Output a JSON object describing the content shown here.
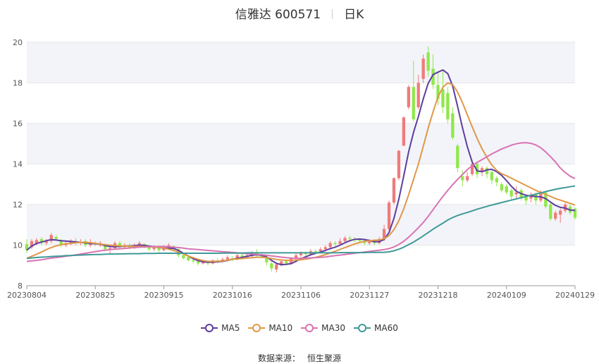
{
  "header": {
    "stock": "信雅达 600571",
    "period": "日K"
  },
  "footer": {
    "source_label": "数据来源：",
    "source_name": "恒生聚源"
  },
  "colors": {
    "up": "#f07b7b",
    "down": "#8fe84a",
    "grid": "#e6e6e6",
    "band": "#f3f4f9"
  },
  "chart_data": {
    "type": "candlestick",
    "ylim": [
      8,
      20
    ],
    "yticks": [
      8,
      10,
      12,
      14,
      16,
      18,
      20
    ],
    "xticks": [
      "20230804",
      "20230825",
      "20230915",
      "20231016",
      "20231106",
      "20231127",
      "20231218",
      "20240109",
      "20240129"
    ],
    "legend_position": "bottom",
    "grid": true,
    "candles": [
      [
        10.05,
        9.75,
        10.3,
        9.6
      ],
      [
        9.9,
        10.2,
        10.3,
        9.8
      ],
      [
        10.1,
        10.25,
        10.35,
        10.0
      ],
      [
        10.3,
        10.1,
        10.4,
        10.0
      ],
      [
        10.1,
        10.2,
        10.3,
        10.0
      ],
      [
        10.2,
        10.5,
        10.6,
        10.1
      ],
      [
        10.4,
        10.3,
        10.5,
        10.2
      ],
      [
        10.2,
        10.0,
        10.3,
        9.9
      ],
      [
        10.0,
        10.1,
        10.2,
        9.9
      ],
      [
        10.05,
        10.2,
        10.3,
        10.0
      ],
      [
        10.2,
        10.1,
        10.35,
        10.0
      ],
      [
        10.1,
        10.15,
        10.3,
        10.0
      ],
      [
        10.2,
        10.0,
        10.3,
        9.9
      ],
      [
        10.0,
        10.15,
        10.3,
        9.9
      ],
      [
        10.1,
        10.05,
        10.2,
        9.95
      ],
      [
        10.0,
        10.1,
        10.2,
        9.9
      ],
      [
        10.05,
        9.8,
        10.1,
        9.7
      ],
      [
        9.8,
        9.85,
        10.0,
        9.6
      ],
      [
        9.85,
        10.1,
        10.2,
        9.8
      ],
      [
        10.1,
        9.9,
        10.2,
        9.8
      ],
      [
        9.9,
        10.0,
        10.1,
        9.8
      ],
      [
        10.0,
        9.85,
        10.1,
        9.8
      ],
      [
        9.9,
        10.0,
        10.1,
        9.8
      ],
      [
        10.0,
        10.1,
        10.2,
        9.9
      ],
      [
        10.05,
        9.95,
        10.1,
        9.85
      ],
      [
        9.95,
        9.8,
        10.0,
        9.7
      ],
      [
        9.8,
        9.9,
        10.0,
        9.7
      ],
      [
        9.9,
        9.75,
        10.0,
        9.65
      ],
      [
        9.75,
        9.9,
        10.0,
        9.7
      ],
      [
        9.9,
        10.0,
        10.1,
        9.8
      ],
      [
        9.95,
        9.8,
        10.0,
        9.7
      ],
      [
        9.8,
        9.5,
        9.85,
        9.4
      ],
      [
        9.5,
        9.35,
        9.6,
        9.3
      ],
      [
        9.4,
        9.25,
        9.5,
        9.2
      ],
      [
        9.25,
        9.2,
        9.35,
        9.1
      ],
      [
        9.2,
        9.1,
        9.3,
        9.0
      ],
      [
        9.1,
        9.15,
        9.25,
        9.05
      ],
      [
        9.15,
        9.1,
        9.2,
        9.0
      ],
      [
        9.1,
        9.25,
        9.3,
        9.05
      ],
      [
        9.25,
        9.2,
        9.35,
        9.1
      ],
      [
        9.2,
        9.3,
        9.4,
        9.15
      ],
      [
        9.3,
        9.4,
        9.5,
        9.2
      ],
      [
        9.35,
        9.3,
        9.45,
        9.2
      ],
      [
        9.3,
        9.5,
        9.6,
        9.25
      ],
      [
        9.5,
        9.4,
        9.6,
        9.3
      ],
      [
        9.4,
        9.5,
        9.6,
        9.35
      ],
      [
        9.5,
        9.6,
        9.7,
        9.4
      ],
      [
        9.6,
        9.5,
        9.8,
        9.4
      ],
      [
        9.5,
        9.4,
        9.6,
        9.35
      ],
      [
        9.4,
        9.15,
        9.45,
        9.0
      ],
      [
        9.1,
        8.85,
        9.2,
        8.7
      ],
      [
        8.8,
        9.05,
        9.1,
        8.65
      ],
      [
        9.0,
        9.2,
        9.3,
        8.95
      ],
      [
        9.2,
        9.1,
        9.3,
        9.0
      ],
      [
        9.1,
        9.35,
        9.4,
        9.05
      ],
      [
        9.35,
        9.5,
        9.6,
        9.3
      ],
      [
        9.5,
        9.6,
        9.7,
        9.4
      ],
      [
        9.6,
        9.55,
        9.7,
        9.45
      ],
      [
        9.55,
        9.7,
        9.8,
        9.5
      ],
      [
        9.7,
        9.65,
        9.8,
        9.55
      ],
      [
        9.7,
        9.8,
        9.9,
        9.6
      ],
      [
        9.8,
        9.9,
        10.0,
        9.7
      ],
      [
        9.9,
        10.1,
        10.2,
        9.8
      ],
      [
        10.1,
        10.05,
        10.2,
        9.95
      ],
      [
        10.05,
        10.2,
        10.35,
        10.0
      ],
      [
        10.2,
        10.35,
        10.45,
        10.1
      ],
      [
        10.35,
        10.3,
        10.45,
        10.2
      ],
      [
        10.3,
        10.25,
        10.4,
        10.15
      ],
      [
        10.25,
        10.2,
        10.35,
        10.1
      ],
      [
        10.2,
        10.1,
        10.3,
        10.0
      ],
      [
        10.1,
        10.2,
        10.3,
        10.0
      ],
      [
        10.2,
        10.1,
        10.3,
        10.0
      ],
      [
        10.1,
        10.3,
        10.4,
        10.05
      ],
      [
        10.3,
        10.8,
        11.0,
        10.2
      ],
      [
        10.8,
        12.1,
        12.2,
        10.7
      ],
      [
        12.1,
        13.3,
        13.35,
        12.0
      ],
      [
        13.3,
        14.65,
        14.7,
        13.2
      ],
      [
        14.9,
        16.3,
        16.35,
        14.9
      ],
      [
        16.8,
        17.8,
        17.9,
        16.7
      ],
      [
        17.8,
        16.2,
        19.1,
        16.1
      ],
      [
        16.8,
        18.0,
        18.4,
        16.7
      ],
      [
        18.2,
        19.2,
        19.4,
        18.0
      ],
      [
        19.5,
        18.6,
        19.8,
        18.3
      ],
      [
        18.7,
        17.9,
        19.4,
        17.7
      ],
      [
        17.9,
        17.2,
        18.5,
        16.9
      ],
      [
        17.7,
        16.8,
        18.6,
        16.5
      ],
      [
        17.5,
        16.2,
        17.8,
        16.0
      ],
      [
        16.5,
        15.3,
        16.8,
        15.2
      ],
      [
        14.9,
        13.8,
        15.0,
        13.6
      ],
      [
        13.4,
        13.2,
        13.7,
        12.9
      ],
      [
        13.2,
        13.4,
        13.6,
        13.1
      ],
      [
        13.5,
        14.0,
        14.2,
        13.4
      ],
      [
        14.0,
        13.5,
        14.1,
        13.3
      ],
      [
        13.6,
        13.8,
        13.9,
        13.4
      ],
      [
        13.8,
        13.5,
        13.9,
        13.3
      ],
      [
        13.6,
        13.2,
        13.7,
        13.0
      ],
      [
        13.3,
        13.1,
        13.4,
        12.9
      ],
      [
        13.0,
        12.7,
        13.1,
        12.6
      ],
      [
        12.9,
        12.6,
        13.0,
        12.5
      ],
      [
        12.7,
        12.4,
        12.8,
        12.2
      ],
      [
        12.5,
        12.6,
        12.9,
        12.3
      ],
      [
        12.7,
        12.3,
        12.8,
        12.2
      ],
      [
        12.4,
        12.2,
        12.5,
        12.0
      ],
      [
        12.3,
        12.5,
        12.6,
        12.1
      ],
      [
        12.5,
        12.2,
        12.6,
        12.0
      ],
      [
        12.2,
        12.6,
        12.7,
        12.1
      ],
      [
        12.6,
        11.9,
        12.65,
        11.8
      ],
      [
        12.0,
        11.3,
        12.1,
        11.2
      ],
      [
        11.3,
        11.6,
        11.7,
        11.2
      ],
      [
        11.5,
        11.7,
        11.8,
        11.1
      ],
      [
        11.7,
        12.0,
        12.1,
        11.6
      ],
      [
        11.9,
        11.6,
        12.0,
        11.5
      ],
      [
        11.8,
        11.35,
        11.85,
        11.25
      ]
    ],
    "series": [
      {
        "name": "MA5",
        "color": "#5c3e9e",
        "values": [
          9.75,
          9.95,
          10.08,
          10.15,
          10.22,
          10.27,
          10.25,
          10.22,
          10.2,
          10.18,
          10.16,
          10.14,
          10.11,
          10.08,
          10.07,
          10.04,
          9.98,
          9.93,
          9.92,
          9.93,
          9.95,
          9.96,
          9.98,
          10.0,
          9.99,
          9.95,
          9.92,
          9.88,
          9.85,
          9.85,
          9.84,
          9.74,
          9.6,
          9.46,
          9.33,
          9.24,
          9.18,
          9.16,
          9.16,
          9.18,
          9.2,
          9.25,
          9.3,
          9.35,
          9.4,
          9.45,
          9.5,
          9.52,
          9.5,
          9.42,
          9.25,
          9.1,
          9.04,
          9.05,
          9.09,
          9.2,
          9.33,
          9.43,
          9.52,
          9.6,
          9.66,
          9.74,
          9.83,
          9.9,
          10.0,
          10.12,
          10.22,
          10.29,
          10.3,
          10.28,
          10.23,
          10.17,
          10.17,
          10.28,
          10.62,
          11.32,
          12.26,
          13.41,
          14.59,
          15.56,
          16.34,
          17.22,
          17.98,
          18.41,
          18.53,
          18.64,
          18.46,
          17.85,
          16.85,
          15.8,
          14.85,
          14.09,
          13.66,
          13.62,
          13.71,
          13.74,
          13.62,
          13.44,
          13.18,
          12.9,
          12.66,
          12.54,
          12.46,
          12.42,
          12.4,
          12.38,
          12.3,
          12.12,
          11.96,
          11.86,
          11.83,
          11.73,
          11.71
        ]
      },
      {
        "name": "MA10",
        "color": "#e09848",
        "values": [
          9.35,
          9.45,
          9.55,
          9.66,
          9.78,
          9.88,
          9.96,
          10.02,
          10.06,
          10.09,
          10.12,
          10.14,
          10.14,
          10.12,
          10.09,
          10.05,
          10.02,
          10.0,
          9.98,
          9.96,
          9.95,
          9.95,
          9.94,
          9.94,
          9.93,
          9.92,
          9.91,
          9.89,
          9.86,
          9.8,
          9.74,
          9.66,
          9.56,
          9.46,
          9.38,
          9.3,
          9.24,
          9.2,
          9.2,
          9.2,
          9.22,
          9.26,
          9.3,
          9.32,
          9.34,
          9.36,
          9.38,
          9.4,
          9.4,
          9.38,
          9.34,
          9.3,
          9.27,
          9.25,
          9.25,
          9.26,
          9.28,
          9.31,
          9.35,
          9.4,
          9.46,
          9.53,
          9.61,
          9.7,
          9.79,
          9.88,
          9.97,
          10.06,
          10.13,
          10.19,
          10.22,
          10.24,
          10.25,
          10.32,
          10.47,
          10.76,
          11.2,
          11.78,
          12.48,
          13.24,
          14.0,
          14.88,
          15.77,
          16.58,
          17.31,
          17.78,
          18.0,
          17.92,
          17.55,
          17.03,
          16.42,
          15.83,
          15.26,
          14.75,
          14.32,
          13.95,
          13.68,
          13.52,
          13.42,
          13.3,
          13.18,
          13.06,
          12.94,
          12.82,
          12.7,
          12.6,
          12.5,
          12.4,
          12.3,
          12.22,
          12.14,
          12.06,
          11.98
        ]
      },
      {
        "name": "MA30",
        "color": "#d873b3",
        "values": [
          9.2,
          9.22,
          9.25,
          9.28,
          9.32,
          9.36,
          9.39,
          9.42,
          9.45,
          9.48,
          9.52,
          9.56,
          9.6,
          9.64,
          9.68,
          9.72,
          9.75,
          9.78,
          9.8,
          9.82,
          9.84,
          9.86,
          9.88,
          9.9,
          9.91,
          9.92,
          9.93,
          9.93,
          9.93,
          9.92,
          9.9,
          9.88,
          9.85,
          9.82,
          9.8,
          9.78,
          9.76,
          9.74,
          9.72,
          9.7,
          9.68,
          9.66,
          9.64,
          9.62,
          9.6,
          9.58,
          9.56,
          9.54,
          9.52,
          9.5,
          9.47,
          9.44,
          9.41,
          9.38,
          9.36,
          9.35,
          9.35,
          9.36,
          9.37,
          9.38,
          9.4,
          9.42,
          9.45,
          9.48,
          9.51,
          9.54,
          9.57,
          9.6,
          9.63,
          9.66,
          9.69,
          9.72,
          9.75,
          9.78,
          9.83,
          9.91,
          10.03,
          10.19,
          10.39,
          10.62,
          10.86,
          11.12,
          11.42,
          11.75,
          12.08,
          12.4,
          12.7,
          12.98,
          13.24,
          13.48,
          13.72,
          13.92,
          14.08,
          14.22,
          14.36,
          14.5,
          14.62,
          14.74,
          14.84,
          14.93,
          15.0,
          15.04,
          15.05,
          15.02,
          14.94,
          14.8,
          14.6,
          14.36,
          14.1,
          13.8,
          13.58,
          13.4,
          13.28
        ]
      },
      {
        "name": "MA60",
        "color": "#3f9a98",
        "values": [
          9.35,
          9.37,
          9.39,
          9.41,
          9.42,
          9.44,
          9.45,
          9.46,
          9.48,
          9.49,
          9.5,
          9.51,
          9.52,
          9.53,
          9.54,
          9.54,
          9.55,
          9.56,
          9.56,
          9.57,
          9.57,
          9.58,
          9.58,
          9.58,
          9.59,
          9.59,
          9.59,
          9.6,
          9.6,
          9.6,
          9.6,
          9.6,
          9.6,
          9.6,
          9.6,
          9.6,
          9.6,
          9.6,
          9.6,
          9.6,
          9.61,
          9.61,
          9.61,
          9.61,
          9.61,
          9.62,
          9.62,
          9.62,
          9.62,
          9.62,
          9.62,
          9.62,
          9.62,
          9.62,
          9.62,
          9.62,
          9.62,
          9.62,
          9.62,
          9.62,
          9.62,
          9.62,
          9.62,
          9.62,
          9.63,
          9.63,
          9.63,
          9.63,
          9.63,
          9.63,
          9.64,
          9.64,
          9.64,
          9.65,
          9.67,
          9.72,
          9.8,
          9.9,
          10.02,
          10.15,
          10.3,
          10.46,
          10.62,
          10.79,
          10.94,
          11.08,
          11.24,
          11.36,
          11.46,
          11.54,
          11.61,
          11.69,
          11.77,
          11.84,
          11.91,
          11.98,
          12.04,
          12.1,
          12.16,
          12.22,
          12.28,
          12.34,
          12.4,
          12.46,
          12.52,
          12.58,
          12.64,
          12.7,
          12.75,
          12.8,
          12.84,
          12.88,
          12.92
        ]
      }
    ]
  }
}
